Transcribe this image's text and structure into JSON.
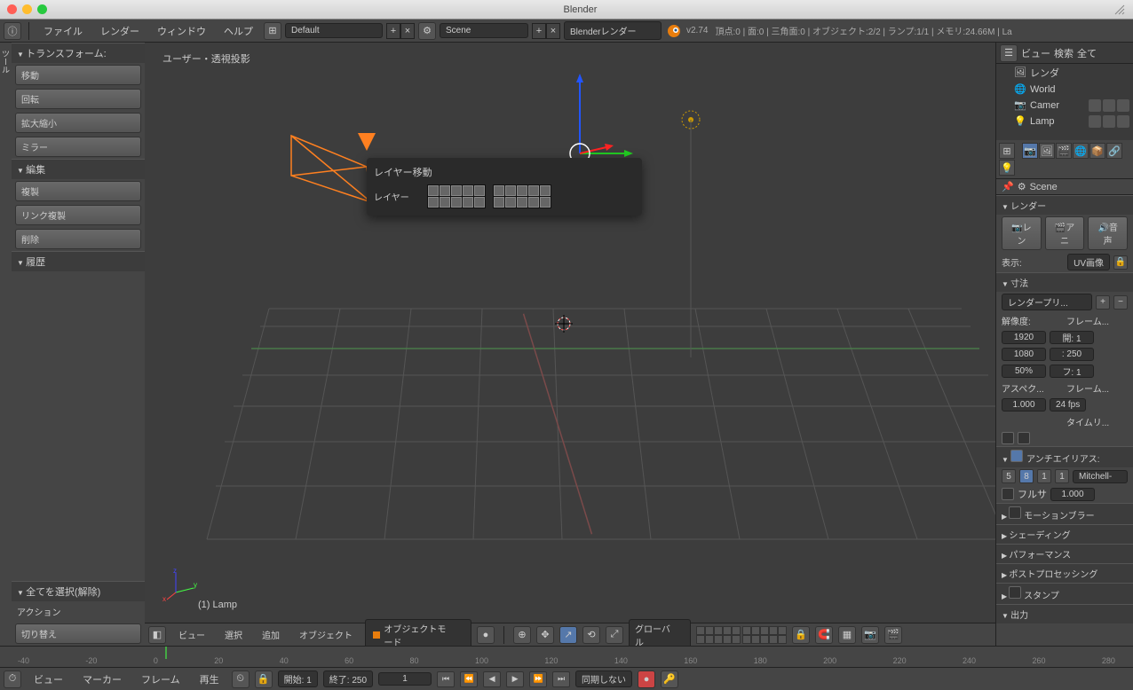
{
  "title": "Blender",
  "menu": {
    "file": "ファイル",
    "render": "レンダー",
    "window": "ウィンドウ",
    "help": "ヘルプ"
  },
  "layout": "Default",
  "scene": "Scene",
  "engine": "Blenderレンダー",
  "version": "v2.74",
  "stats": "頂点:0 | 面:0 | 三角面:0 | オブジェクト:2/2 | ランプ:1/1 | メモリ:24.66M | La",
  "toolpanel": {
    "transform": {
      "title": "トランスフォーム:",
      "translate": "移動",
      "rotate": "回転",
      "scale": "拡大縮小",
      "mirror": "ミラー"
    },
    "edit": {
      "title": "編集",
      "duplicate": "複製",
      "duplink": "リンク複製",
      "delete": "削除"
    },
    "history": {
      "title": "履歴"
    }
  },
  "select_all": "全てを選択(解除)",
  "action_label": "アクション",
  "action": "切り替え",
  "viewport": {
    "label": "ユーザー・透視投影",
    "sel": "(1) Lamp"
  },
  "popup": {
    "title": "レイヤー移動",
    "label": "レイヤー"
  },
  "outliner": {
    "view": "ビュー",
    "search": "検索",
    "all": "全て",
    "render": "レンダ",
    "world": "World",
    "camera": "Camer",
    "lamp": "Lamp"
  },
  "props_scene": "Scene",
  "props": {
    "render": "レンダー",
    "render_btn": "レン",
    "anim_btn": "アニ",
    "audio_btn": "音声",
    "display": "表示:",
    "display_val": "UV画像",
    "dimensions": "寸法",
    "preset": "レンダープリ...",
    "res": "解像度:",
    "res_x": "1920",
    "res_y": "1080",
    "res_pct": "50%",
    "frame": "フレーム...",
    "start": "開: 1",
    "end": ": 250",
    "step": "フ: 1",
    "aspect": "アスペク...",
    "aspect_x": "1.000",
    "framerate": "フレーム...",
    "fps": "24 fps",
    "timeli": "タイムリ...",
    "aa": "アンチエイリアス:",
    "aa_5": "5",
    "aa_8": "8",
    "aa_11": "1",
    "aa_16": "1",
    "filter": "Mitchell-",
    "fullsample": "フルサ",
    "fullsample_val": "1.000",
    "motion": "モーションブラー",
    "shading": "シェーディング",
    "perf": "パフォーマンス",
    "post": "ポストプロセッシング",
    "stamp": "スタンプ",
    "output": "出力"
  },
  "viewbar": {
    "view": "ビュー",
    "select": "選択",
    "add": "追加",
    "object": "オブジェクト",
    "mode": "オブジェクトモード",
    "global": "グローバル"
  },
  "timeline_ticks": [
    "-40",
    "-20",
    "0",
    "20",
    "40",
    "60",
    "80",
    "100",
    "120",
    "140",
    "160",
    "180",
    "200",
    "220",
    "240",
    "260",
    "280"
  ],
  "timebar": {
    "view": "ビュー",
    "marker": "マーカー",
    "frame": "フレーム",
    "play": "再生",
    "start": "開始:",
    "start_v": "1",
    "end": "終了:",
    "end_v": "250",
    "cur": "1",
    "sync": "同期しない"
  }
}
